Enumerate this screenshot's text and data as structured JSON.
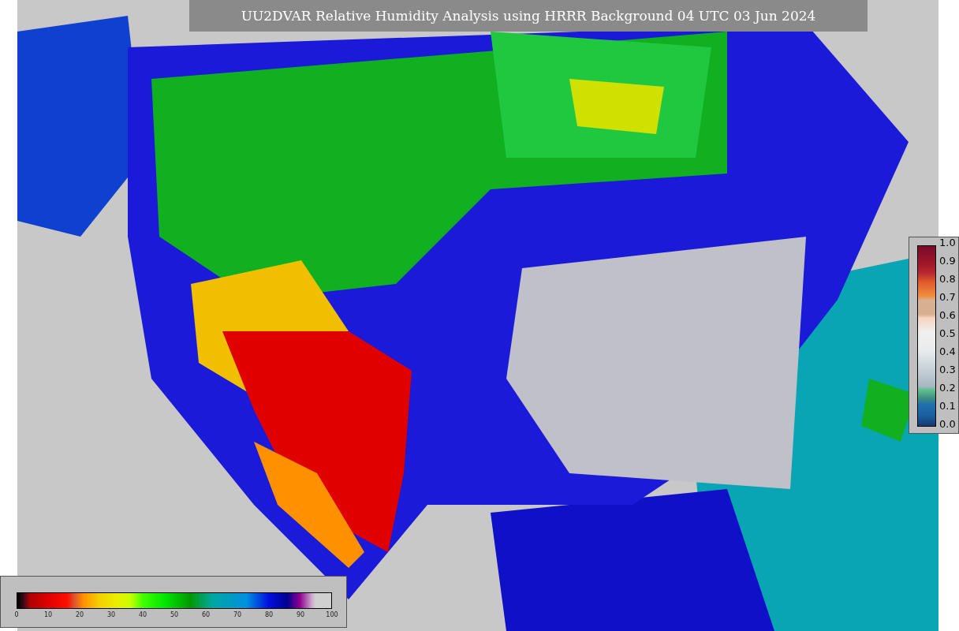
{
  "title": "UU2DVAR Relative Humidity Analysis using HRRR Background 04 UTC 03 Jun 2024",
  "humidity_legend": {
    "labels": [
      "0",
      "10",
      "20",
      "30",
      "40",
      "50",
      "60",
      "70",
      "80",
      "90",
      "100"
    ]
  },
  "scale_legend": {
    "labels": [
      "1.0",
      "0.9",
      "0.8",
      "0.7",
      "0.6",
      "0.5",
      "0.4",
      "0.3",
      "0.2",
      "0.1",
      "0.0"
    ]
  }
}
